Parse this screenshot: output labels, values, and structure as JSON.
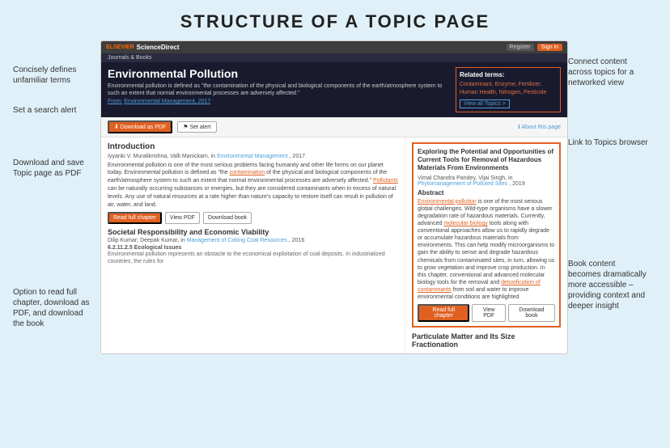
{
  "page": {
    "title": "STRUCTURE OF A TOPIC PAGE"
  },
  "browser": {
    "logo": "ScienceDirect",
    "nav_items": [
      "Journals & Books"
    ],
    "buttons": [
      "Register",
      "Sign in"
    ]
  },
  "topic_header": {
    "title": "Environmental Pollution",
    "description": "Environmental pollution is defined as \"the contamination of the physical and biological components of the earth/atmosphere system to such an extent that normal environmental processes are adversely affected.\"",
    "source_label": "From:",
    "source_link": "Environmental Management, 2017",
    "related_terms_label": "Related terms:",
    "related_terms": "Contaminant, Enzyme, Fertilizer, Human Health, Nitrogen, Pesticide",
    "view_all_btn": "View all Topics >"
  },
  "action_bar": {
    "download_pdf_btn": "⬇ Download as PDF",
    "set_alert_btn": "⚑ Set alert",
    "about_link": "ℹ About this page"
  },
  "left_column": {
    "intro_heading": "Introduction",
    "intro_authors": "Iyyanki V. Muralikrishna, Valli Manickam, in",
    "intro_journal": "Environmental Management",
    "intro_year": ", 2017",
    "intro_body": "Environmental pollution is one of the most serious problems facing humanity and other life forms on our planet today. Environmental pollution is defined as \"the contamination of the physical and biological components of the earth/atmosphere system to such an extent that normal environmental processes are adversely affected.\" Pollutants can be naturally occurring substances or energies, but they are considered contaminants when in excess of natural levels. Any use of natural resources at a rate higher than nature's capacity to restore itself can result in pollution of air, water, and land.",
    "read_chapter_btn": "Read full chapter",
    "view_pdf_btn": "View PDF",
    "download_book_btn": "Download book",
    "section2_heading": "Societal Responsibility and Economic Viability",
    "section2_authors": "Dilip Kumar; Deepak Kumar, in",
    "section2_journal": "Management of Coking Coal Resources",
    "section2_year": ", 2016",
    "section2_sub": "6.2.11.2.5 Ecological Issues",
    "section2_body": "Environmental pollution represents an obstacle to the economical exploitation of coal deposits. In industrialized countries, the rules for"
  },
  "right_column": {
    "featured_title": "Exploring the Potential and Opportunities of Current Tools for Removal of Hazardous Materials From Environments",
    "featured_authors": "Vimal Chandra Pandey, Vijai Singh, in",
    "featured_journal": "Phytomanagement of Polluted Sites",
    "featured_year": ", 2019",
    "abstract_label": "Abstract",
    "featured_body": "Environmental pollution is one of the most serious global challenges. Wild-type organisms have a slower degradation rate of hazardous materials. Currently, advanced molecular biology tools along with conventional approaches allow us to rapidly degrade or accumulate hazardous materials from environments. This can help modify microorganisms to gain the ability to sense and degrade hazardous chemicals from contaminated sites, in turn, allowing us to grow vegetation and improve crop production. In this chapter, conventional and advanced molecular biology tools for the removal and detoxification of contaminants from soil and water to improve environmental conditions are highlighted.",
    "read_chapter_btn": "Read full chapter",
    "view_pdf_btn": "View PDF",
    "download_book_btn": "Download book",
    "second_title": "Particulate Matter and Its Size Fractionation"
  },
  "left_annotations": {
    "ann1": "Concisely defines unfamiliar terms",
    "ann2": "Set a search alert",
    "ann3": "Download and save Topic page as PDF",
    "ann4": "Option to read full chapter, download as PDF, and download the book"
  },
  "right_annotations": {
    "ann1": "Connect content across topics for a networked view",
    "ann2": "Link to Topics browser",
    "ann3": "Book content becomes dramatically more accessible – providing context and deeper insight"
  }
}
